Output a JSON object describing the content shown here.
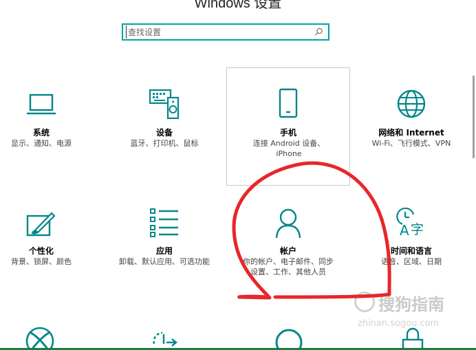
{
  "window": {
    "title": "Windows 设置"
  },
  "search": {
    "placeholder": "查找设置"
  },
  "tiles": [
    {
      "name": "系统",
      "desc": "显示、通知、电源",
      "icon": "laptop-icon"
    },
    {
      "name": "设备",
      "desc": "蓝牙、打印机、鼠标",
      "icon": "devices-icon"
    },
    {
      "name": "手机",
      "desc": "连接 Android 设备、iPhone",
      "icon": "phone-icon"
    },
    {
      "name": "网络和 Internet",
      "desc": "Wi-Fi、飞行模式、VPN",
      "icon": "globe-icon"
    },
    {
      "name": "个性化",
      "desc": "背景、锁屏、颜色",
      "icon": "personalization-icon"
    },
    {
      "name": "应用",
      "desc": "卸载、默认应用、可选功能",
      "icon": "apps-list-icon"
    },
    {
      "name": "帐户",
      "desc": "你的帐户、电子邮件、同步设置、工作、其他人员",
      "icon": "person-icon"
    },
    {
      "name": "时间和语言",
      "desc": "语音、区域、日期",
      "icon": "time-language-icon"
    }
  ],
  "bottom_row_icons": [
    "xbox-icon",
    "update-icon",
    "ease-of-access-icon",
    "lock-icon"
  ],
  "watermark": {
    "text": "搜狗指南",
    "subtext": "zhinan.sogou.com"
  },
  "colors": {
    "accent": "#00a2a2",
    "annotation": "#e8262b",
    "taskbar": "#1e7d3a"
  }
}
